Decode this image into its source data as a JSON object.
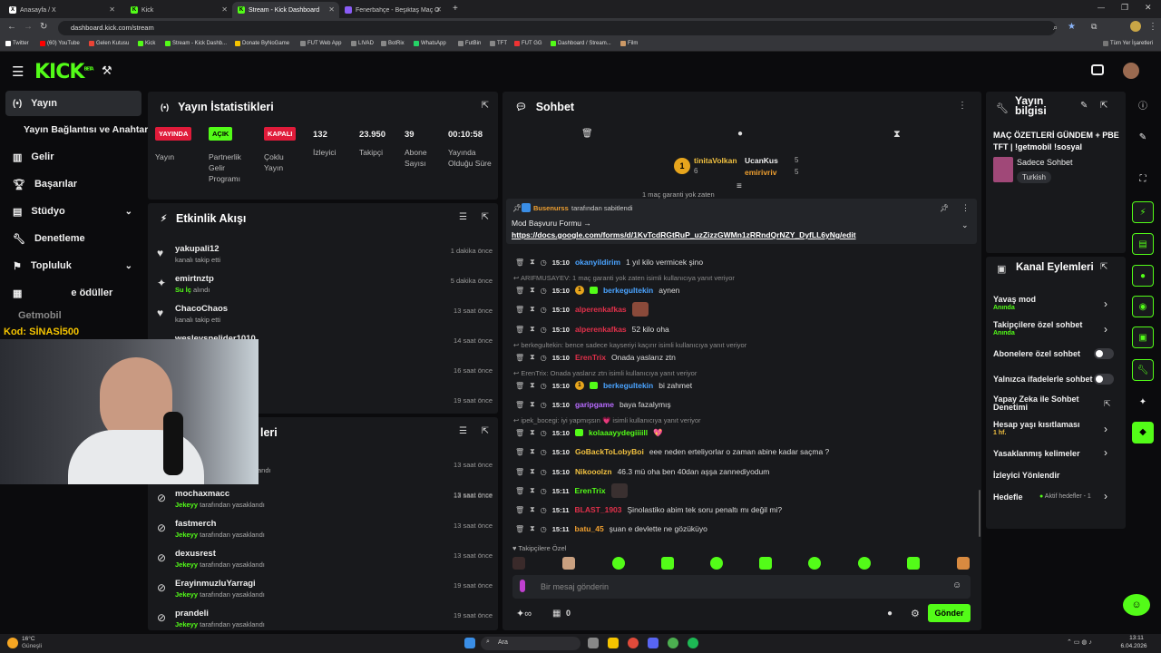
{
  "browser": {
    "tabs": [
      {
        "label": "Anasayfa / X",
        "icon": "x-icon"
      },
      {
        "label": "Kick",
        "icon": "kick-icon"
      },
      {
        "label": "Stream - Kick Dashboard",
        "icon": "kick-icon"
      },
      {
        "label": "Fenerbahçe - Beşiktaş Maç Özeti",
        "icon": "page-icon"
      }
    ],
    "url": "dashboard.kick.com/stream",
    "bookmarks": [
      "Twitter",
      "(60) YouTube",
      "Gelen Kutusu",
      "Kick",
      "Stream - Kick Dashb...",
      "Donate ByNoGame",
      "FUT Web App",
      "LIVAD",
      "BotRix",
      "WhatsApp",
      "FutBin",
      "TFT",
      "FUT GG",
      "Dashboard / Stream...",
      "Film"
    ],
    "all_bookmarks": "Tüm Yer İşaretleri"
  },
  "app": {
    "logo": "KICK",
    "logo_sup": "BETA"
  },
  "sidebar": {
    "items": [
      {
        "label": "Yayın",
        "icon": "broadcast-icon"
      },
      {
        "label": "Yayın Bağlantısı ve Anahtarı",
        "icon": ""
      },
      {
        "label": "Gelir",
        "icon": "revenue-icon"
      },
      {
        "label": "Başarılar",
        "icon": "trophy-icon"
      },
      {
        "label": "Stüdyo",
        "icon": "studio-icon"
      },
      {
        "label": "Denetleme",
        "icon": "wrench-icon"
      },
      {
        "label": "Topluluk",
        "icon": "community-icon"
      },
      {
        "label": "e ödüller",
        "icon": "gift-icon"
      }
    ]
  },
  "overlay": {
    "watermark": "Getmobil",
    "code": "Kod: SİNASİ500"
  },
  "stats": {
    "title": "Yayın İstatistikleri",
    "items": [
      {
        "badge": "YAYINDA",
        "badge_color": "#e01b3a",
        "label": "Yayın"
      },
      {
        "badge": "AÇIK",
        "badge_color": "#53fc18",
        "label": "Partnerlik Gelir Programı"
      },
      {
        "badge": "KAPALI",
        "badge_color": "#e01b3a",
        "label": "Çoklu Yayın"
      },
      {
        "value": "132",
        "label": "İzleyici"
      },
      {
        "value": "23.950",
        "label": "Takipçi"
      },
      {
        "value": "39",
        "label": "Abone Sayısı"
      },
      {
        "value": "00:10:58",
        "label": "Yayında Olduğu Süre"
      }
    ]
  },
  "activity": {
    "title": "Etkinlik Akışı",
    "items": [
      {
        "name": "yakupali12",
        "sub": "kanalı takip etti",
        "time": "1 dakika önce",
        "icon": "heart-icon"
      },
      {
        "name": "emirtnztp",
        "sub_em": "Su İç",
        "sub": "alındı",
        "time": "5 dakika önce",
        "icon": "sparkle-icon"
      },
      {
        "name": "ChacoChaos",
        "sub": "kanalı takip etti",
        "time": "13 saat önce",
        "icon": "heart-icon"
      },
      {
        "name": "wesleysnelider1010",
        "sub": "",
        "time": "14 saat önce",
        "icon": "heart-icon"
      },
      {
        "name": "",
        "sub": "",
        "time": "16 saat önce",
        "icon": ""
      },
      {
        "name": "",
        "sub": "",
        "time": "19 saat önce",
        "icon": ""
      }
    ]
  },
  "bans": {
    "title_partial": "leri",
    "items": [
      {
        "name": "",
        "by": "",
        "sub": "",
        "time": "13 saat önce"
      },
      {
        "name": "",
        "by": "",
        "sub": "andı",
        "time": "13 saat önce"
      },
      {
        "name": "mochaxmacc",
        "by": "Jekeyy",
        "sub": "tarafından yasaklandı",
        "time": "13 saat önce"
      },
      {
        "name": "fastmerch",
        "by": "Jekeyy",
        "sub": "tarafından yasaklandı",
        "time": "13 saat önce"
      },
      {
        "name": "dexusrest",
        "by": "Jekeyy",
        "sub": "tarafından yasaklandı",
        "time": "13 saat önce"
      },
      {
        "name": "ErayinmuzluYarragi",
        "by": "Jekeyy",
        "sub": "tarafından yasaklandı",
        "time": "19 saat önce"
      },
      {
        "name": "prandeli",
        "by": "Jekeyy",
        "sub": "tarafından yasaklandı",
        "time": "19 saat önce"
      }
    ]
  },
  "chat": {
    "title": "Sohbet",
    "top": [
      {
        "rank": "1",
        "name": "tinitaVolkan",
        "count": "6"
      },
      {
        "name": "UcanKus",
        "count": "5"
      },
      {
        "name": "emirivriv",
        "count": "5"
      }
    ],
    "partial_top": "1 maç garanti yok zaten",
    "pinned": {
      "by": "Busenurss",
      "by_suffix": "tarafından sabitlendi",
      "title": "Mod Başvuru Formu →",
      "link": "https://docs.google.com/forms/d/1KvTcdRGtRuP_uzZizzGWMn1zRRndQrNZY_DyfLL6yNg/edit"
    },
    "messages": [
      {
        "type": "msg",
        "time": "15:10",
        "user": "okanyildirim",
        "color": "#4aa3ff",
        "text": "1 yıl kilo vermicek şino"
      },
      {
        "type": "reply",
        "text": "ARIFMUSAYEV: 1 maç garanti yok zaten isimli kullanıcıya yanıt veriyor"
      },
      {
        "type": "msg",
        "time": "15:10",
        "user": "berkegultekin",
        "color": "#4aa3ff",
        "text": "aynen",
        "badges": "og"
      },
      {
        "type": "msg",
        "time": "15:10",
        "user": "alperenkafkas",
        "color": "#e0304a",
        "text": "",
        "emote": true
      },
      {
        "type": "msg",
        "time": "15:10",
        "user": "alperenkafkas",
        "color": "#e0304a",
        "text": "52 kilo oha"
      },
      {
        "type": "reply",
        "text": "berkegultekin: bence sadece kayseriyi kaçırır isimli kullanıcıya yanıt veriyor"
      },
      {
        "type": "msg",
        "time": "15:10",
        "user": "ErenTrix",
        "color": "#e0304a",
        "text": "Onada yaslarız ztn"
      },
      {
        "type": "reply",
        "text": "ErenTrix: Onada yaslarız ztn isimli kullanıcıya yanıt veriyor"
      },
      {
        "type": "msg",
        "time": "15:10",
        "user": "berkegultekin",
        "color": "#4aa3ff",
        "text": "bi zahmet",
        "badges": "og"
      },
      {
        "type": "msg",
        "time": "15:10",
        "user": "garipgame",
        "color": "#b86bff",
        "text": "baya fazalymış"
      },
      {
        "type": "reply",
        "text": "ipek_bocegi: iyi yapmışsın 💗 isimli kullanıcıya yanıt veriyor"
      },
      {
        "type": "msg",
        "time": "15:10",
        "user": "kolaaayydegiiiill",
        "color": "#53fc18",
        "text": "💖",
        "badges": "g"
      },
      {
        "type": "msg",
        "time": "15:10",
        "user": "GoBackToLobyBoi",
        "color": "#f0c040",
        "text": "eee neden erteliyorlar o zaman abine kadar saçma ?"
      },
      {
        "type": "msg",
        "time": "15:10",
        "user": "Nikooolzn",
        "color": "#f0c040",
        "text": "46.3 mü oha ben 40dan aşşa zannediyodum"
      },
      {
        "type": "msg",
        "time": "15:11",
        "user": "ErenTrix",
        "color": "#53fc18",
        "text": "",
        "emote": true
      },
      {
        "type": "msg",
        "time": "15:11",
        "user": "BLAST_1903",
        "color": "#e0304a",
        "text": "Şinolastiko abim tek soru penaltı mı değil mi?"
      },
      {
        "type": "msg",
        "time": "15:11",
        "user": "batu_45",
        "color": "#f0a030",
        "text": "şuan e devlette ne gözüküyo"
      }
    ],
    "follower_only": "Takipçilere Özel",
    "input_placeholder": "Bir mesaj gönderin",
    "counter": "0",
    "send_label": "Gönder"
  },
  "stream_info": {
    "title": "Yayın bilgisi",
    "stream_title": "MAÇ ÖZETLERİ GÜNDEM + PBE TFT | !getmobil !sosyal",
    "category": "Sadece Sohbet",
    "language": "Turkish"
  },
  "channel_actions": {
    "title": "Kanal Eylemleri",
    "items": [
      {
        "label": "Yavaş mod",
        "sub": "Anında",
        "control": "chevron"
      },
      {
        "label": "Takipçilere özel sohbet",
        "sub": "Anında",
        "control": "chevron"
      },
      {
        "label": "Abonelere özel sohbet",
        "sub": "",
        "control": "toggle"
      },
      {
        "label": "Yalnızca ifadelerle sohbet",
        "sub": "",
        "control": "toggle"
      },
      {
        "label": "Yapay Zeka ile Sohbet Denetimi",
        "sub": "",
        "control": "external"
      },
      {
        "label": "Hesap yaşı kısıtlaması",
        "sub": "1 hf.",
        "control": "chevron"
      },
      {
        "label": "Yasaklanmış kelimeler",
        "sub": "",
        "control": "chevron"
      },
      {
        "label": "İzleyici Yönlendir",
        "sub": "",
        "control": "none"
      },
      {
        "label": "Hedefle",
        "sub": "Aktif hedefler - 1",
        "control": "chevron"
      }
    ]
  },
  "taskbar": {
    "weather_temp": "16°C",
    "weather_text": "Güneşli",
    "search": "Ara",
    "time": "13:11",
    "date": "6.04.2026"
  }
}
